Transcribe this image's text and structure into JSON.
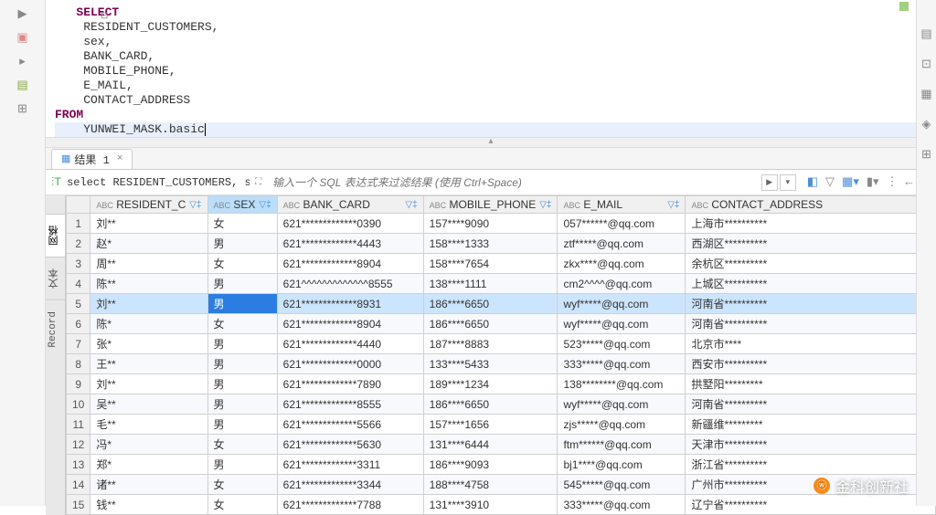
{
  "editor": {
    "keyword_select": "SELECT",
    "line_resident": "    RESIDENT_CUSTOMERS,",
    "line_sex": "    sex,",
    "line_bankcard": "    BANK_CARD,",
    "line_phone": "    MOBILE_PHONE,",
    "line_email": "    E_MAIL,",
    "line_address": "    CONTACT_ADDRESS",
    "keyword_from": "FROM",
    "line_table": "    YUNWEI_MASK.basic"
  },
  "results_tab": {
    "label": "结果 1"
  },
  "filter": {
    "sql_preview": "select RESIDENT_CUSTOMERS, sex, BANK",
    "placeholder": "输入一个 SQL 表达式来过滤结果 (使用 Ctrl+Space)"
  },
  "vtabs": {
    "a": "网格",
    "b": "文本",
    "c": "Record"
  },
  "columns": {
    "resident": "RESIDENT_C",
    "sex": "SEX",
    "bank": "BANK_CARD",
    "mobile": "MOBILE_PHONE",
    "email": "E_MAIL",
    "addr": "CONTACT_ADDRESS",
    "type_prefix": "ABC"
  },
  "rows": [
    {
      "n": "1",
      "r": "刘**",
      "s": "女",
      "b": "621*************0390",
      "m": "157****9090",
      "e": "057******@qq.com",
      "a": "上海市**********"
    },
    {
      "n": "2",
      "r": "赵*",
      "s": "男",
      "b": "621*************4443",
      "m": "158****1333",
      "e": "ztf*****@qq.com",
      "a": "西湖区**********"
    },
    {
      "n": "3",
      "r": "周**",
      "s": "女",
      "b": "621*************8904",
      "m": "158****7654",
      "e": "zkx****@qq.com",
      "a": "余杭区**********"
    },
    {
      "n": "4",
      "r": "陈**",
      "s": "男",
      "b": "621^^^^^^^^^^^^^8555",
      "m": "138****1111",
      "e": "cm2^^^^@qq.com",
      "a": "上城区**********"
    },
    {
      "n": "5",
      "r": "刘**",
      "s": "男",
      "b": "621*************8931",
      "m": "186****6650",
      "e": "wyf*****@qq.com",
      "a": "河南省**********"
    },
    {
      "n": "6",
      "r": "陈*",
      "s": "女",
      "b": "621*************8904",
      "m": "186****6650",
      "e": "wyf*****@qq.com",
      "a": "河南省**********"
    },
    {
      "n": "7",
      "r": "张*",
      "s": "男",
      "b": "621*************4440",
      "m": "187****8883",
      "e": "523*****@qq.com",
      "a": "北京市****"
    },
    {
      "n": "8",
      "r": "王**",
      "s": "男",
      "b": "621*************0000",
      "m": "133****5433",
      "e": "333*****@qq.com",
      "a": "西安市**********"
    },
    {
      "n": "9",
      "r": "刘**",
      "s": "男",
      "b": "621*************7890",
      "m": "189****1234",
      "e": "138********@qq.com",
      "a": "拱墅阳*********"
    },
    {
      "n": "10",
      "r": "吴**",
      "s": "男",
      "b": "621*************8555",
      "m": "186****6650",
      "e": "wyf*****@qq.com",
      "a": "河南省**********"
    },
    {
      "n": "11",
      "r": "毛**",
      "s": "男",
      "b": "621*************5566",
      "m": "157****1656",
      "e": "zjs*****@qq.com",
      "a": "新疆维*********"
    },
    {
      "n": "12",
      "r": "冯*",
      "s": "女",
      "b": "621*************5630",
      "m": "131****6444",
      "e": "ftm******@qq.com",
      "a": "天津市**********"
    },
    {
      "n": "13",
      "r": "郑*",
      "s": "男",
      "b": "621*************3311",
      "m": "186****9093",
      "e": "bj1****@qq.com",
      "a": "浙江省**********"
    },
    {
      "n": "14",
      "r": "诸**",
      "s": "女",
      "b": "621*************3344",
      "m": "188****4758",
      "e": "545*****@qq.com",
      "a": "广州市**********"
    },
    {
      "n": "15",
      "r": "钱**",
      "s": "女",
      "b": "621*************7788",
      "m": "131****3910",
      "e": "333*****@qq.com",
      "a": "辽宁省**********"
    }
  ],
  "watermark": "金科创新社"
}
